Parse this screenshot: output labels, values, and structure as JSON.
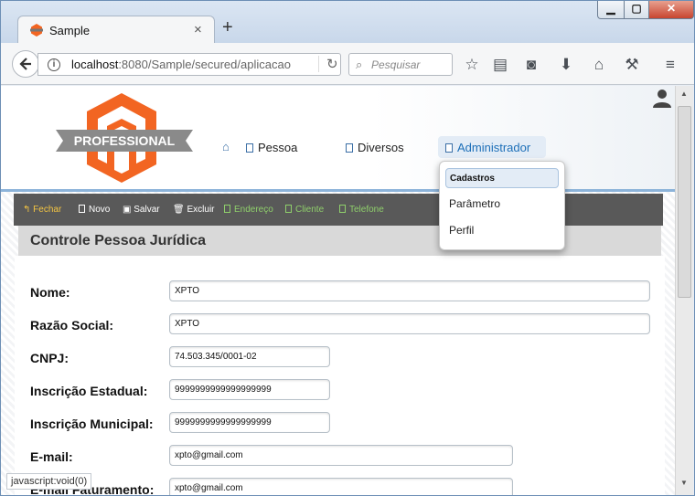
{
  "browser": {
    "tab_title": "Sample",
    "tab_close": "×",
    "new_tab": "+",
    "window_controls": {
      "minimize": "▁",
      "maximize": "▢",
      "close": "✕"
    },
    "url_host": "localhost",
    "url_rest": ":8080/Sample/secured/aplicacao",
    "search_placeholder": "Pesquisar",
    "toolbar_icons": [
      "bookmark-star-icon",
      "reading-list-icon",
      "pocket-icon",
      "download-icon",
      "home-icon",
      "dev-tool-icon",
      "menu-icon"
    ],
    "status_text": "javascript:void(0)"
  },
  "header": {
    "logo_text": "PROFESSIONAL",
    "menu": [
      {
        "label": "Pessoa"
      },
      {
        "label": "Diversos"
      },
      {
        "label": "Administrador"
      }
    ]
  },
  "dropdown": {
    "header": "Cadastros",
    "items": [
      "Parâmetro",
      "Perfil"
    ]
  },
  "toolbar": {
    "buttons": [
      "Fechar",
      "Novo",
      "Salvar",
      "Excluir",
      "Endereço",
      "Cliente",
      "Telefone"
    ]
  },
  "panel": {
    "title": "Controle Pessoa Jurídica"
  },
  "form": {
    "fields": [
      {
        "label": "Nome:",
        "value": "XPTO"
      },
      {
        "label": "Razão Social:",
        "value": "XPTO"
      },
      {
        "label": "CNPJ:",
        "value": "74.503.345/0001-02"
      },
      {
        "label": "Inscrição Estadual:",
        "value": "9999999999999999999"
      },
      {
        "label": "Inscrição Municipal:",
        "value": "9999999999999999999"
      },
      {
        "label": "E-mail:",
        "value": "xpto@gmail.com"
      },
      {
        "label": "E-mail Faturamento:",
        "value": "xpto@gmail.com"
      }
    ]
  },
  "colors": {
    "accent": "#1d6fb8",
    "logo_orange": "#f26522",
    "toolbar_bg": "#595959",
    "fechar": "#f4c542",
    "disabled_green": "#8fcf6b"
  }
}
